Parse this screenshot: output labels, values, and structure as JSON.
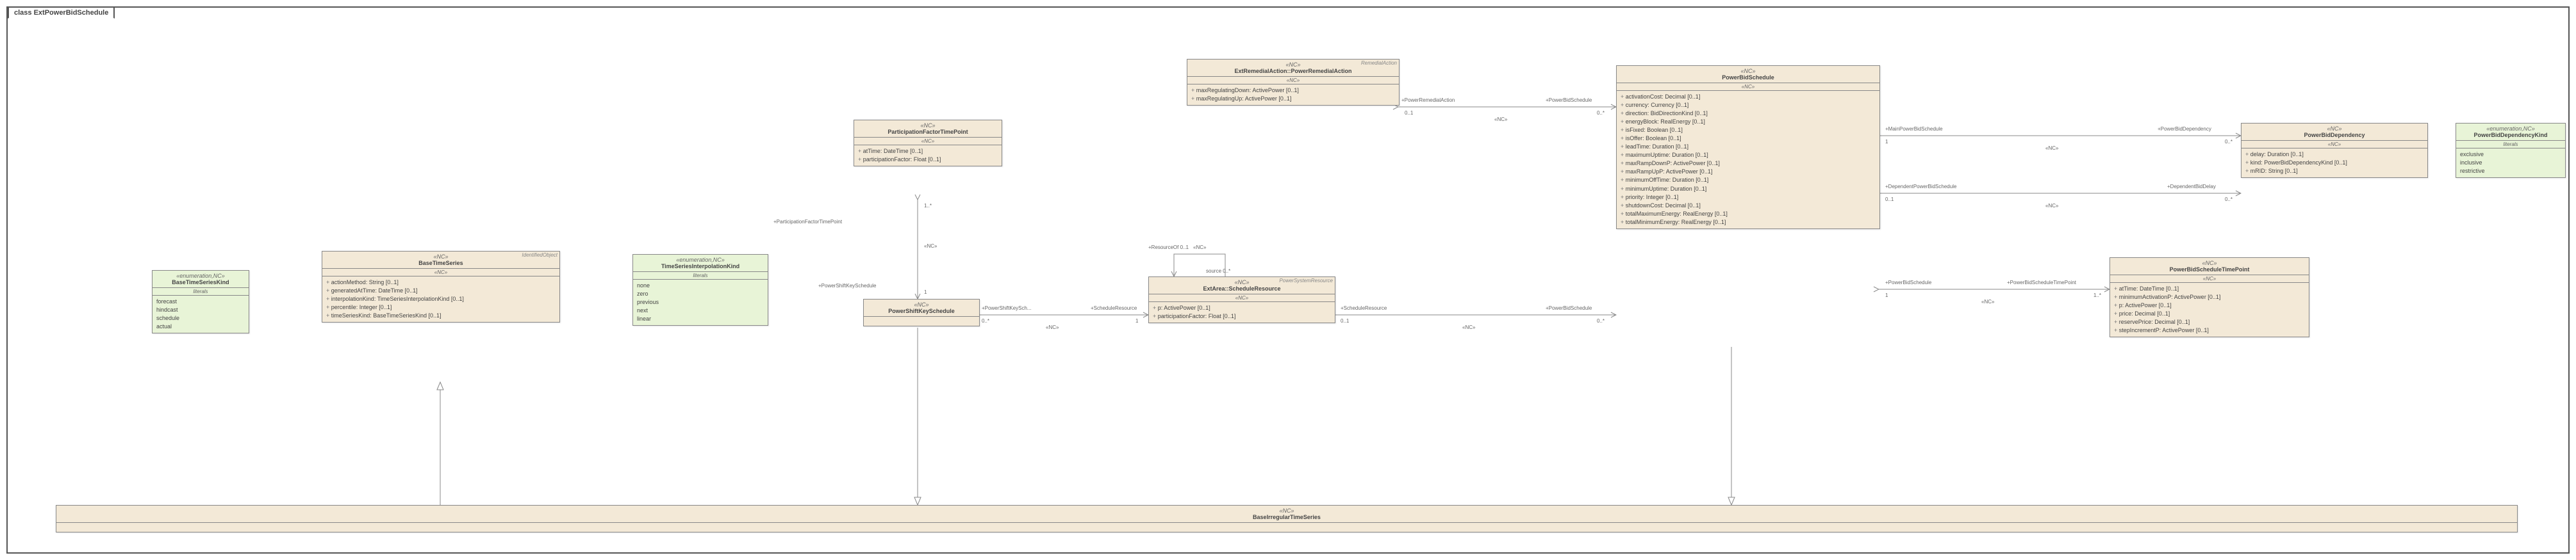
{
  "frame_title": "class ExtPowerBidSchedule",
  "enums": {
    "baseTimeSeriesKind": {
      "stereo": "«enumeration,NC»",
      "name": "BaseTimeSeriesKind",
      "literals": [
        "forecast",
        "hindcast",
        "schedule",
        "actual"
      ]
    },
    "tsInterp": {
      "stereo": "«enumeration,NC»",
      "name": "TimeSeriesInterpolationKind",
      "literals": [
        "none",
        "zero",
        "previous",
        "next",
        "linear"
      ]
    },
    "pbDepKind": {
      "stereo": "«enumeration,NC»",
      "name": "PowerBidDependencyKind",
      "literals": [
        "exclusive",
        "inclusive",
        "restrictive"
      ]
    }
  },
  "classes": {
    "baseTimeSeries": {
      "stereo": "«NC»",
      "name": "BaseTimeSeries",
      "parent": "IdentifiedObject",
      "attrs": [
        "actionMethod: String [0..1]",
        "generatedAtTime: DateTime [0..1]",
        "interpolationKind: TimeSeriesInterpolationKind [0..1]",
        "percentile: Integer [0..1]",
        "timeSeriesKind: BaseTimeSeriesKind [0..1]"
      ]
    },
    "pfTimePoint": {
      "stereo": "«NC»",
      "name": "ParticipationFactorTimePoint",
      "attrs": [
        "atTime: DateTime [0..1]",
        "participationFactor: Float [0..1]"
      ]
    },
    "psKeySched": {
      "stereo": "«NC»",
      "name": "PowerShiftKeySchedule"
    },
    "schedRes": {
      "stereo": "«NC»",
      "name": "ExtArea::ScheduleResource",
      "parent": "PowerSystemResource",
      "attrs": [
        "p: ActivePower [0..1]",
        "participationFactor: Float [0..1]"
      ]
    },
    "powerRA": {
      "stereo": "«NC»",
      "name": "ExtRemedialAction::PowerRemedialAction",
      "parent": "RemedialAction",
      "attrs": [
        "maxRegulatingDown: ActivePower [0..1]",
        "maxRegulatingUp: ActivePower [0..1]"
      ]
    },
    "pbSched": {
      "stereo": "«NC»",
      "name": "PowerBidSchedule",
      "attrs": [
        "activationCost: Decimal [0..1]",
        "currency: Currency [0..1]",
        "direction: BidDirectionKind [0..1]",
        "energyBlock: RealEnergy [0..1]",
        "isFixed: Boolean [0..1]",
        "isOffer: Boolean [0..1]",
        "leadTime: Duration [0..1]",
        "maximumUptime: Duration [0..1]",
        "maxRampDownP: ActivePower [0..1]",
        "maxRampUpP: ActivePower [0..1]",
        "minimumOffTime: Duration [0..1]",
        "minimumUptime: Duration [0..1]",
        "priority: Integer [0..1]",
        "shutdownCost: Decimal [0..1]",
        "totalMaximumEnergy: RealEnergy [0..1]",
        "totalMinimumEnergy: RealEnergy [0..1]"
      ]
    },
    "pbDep": {
      "stereo": "«NC»",
      "name": "PowerBidDependency",
      "attrs": [
        "delay: Duration [0..1]",
        "kind: PowerBidDependencyKind [0..1]",
        "mRID: String [0..1]"
      ]
    },
    "pbStp": {
      "stereo": "«NC»",
      "name": "PowerBidScheduleTimePoint",
      "attrs": [
        "atTime: DateTime [0..1]",
        "minimumActivationP: ActivePower [0..1]",
        "p: ActivePower [0..1]",
        "price: Decimal [0..1]",
        "reservePrice: Decimal [0..1]",
        "stepIncrementP: ActivePower [0..1]"
      ]
    },
    "baseIrr": {
      "stereo": "«NC»",
      "name": "BaseIrregularTimeSeries"
    }
  },
  "labels": {
    "pftp1": "+ParticipationFactorTimePoint",
    "m1s": "1..*",
    "psks": "+PowerShiftKeySchedule",
    "m1": "1",
    "pskSch": "+PowerShiftKeySch...",
    "m0s": "0..*",
    "schRes": "+ScheduleResource",
    "schRes2": "+ScheduleResource",
    "resOf": "+ResourceOf  0..1",
    "resSrc": "source 0..*",
    "pra": "+PowerRemedialAction",
    "m01": "0..1",
    "pbs": "+PowerBidSchedule",
    "pbs2": "+PowerBidSchedule",
    "m0s2": "0..*",
    "main": "+MainPowerBidSchedule",
    "pbd": "+PowerBidDependency",
    "depS": "+DependentPowerBidSchedule",
    "depD": "+DependentBidDelay",
    "pbs3": "+PowerBidSchedule",
    "pbstp": "+PowerBidScheduleTimePoint",
    "nc": "«NC»"
  }
}
